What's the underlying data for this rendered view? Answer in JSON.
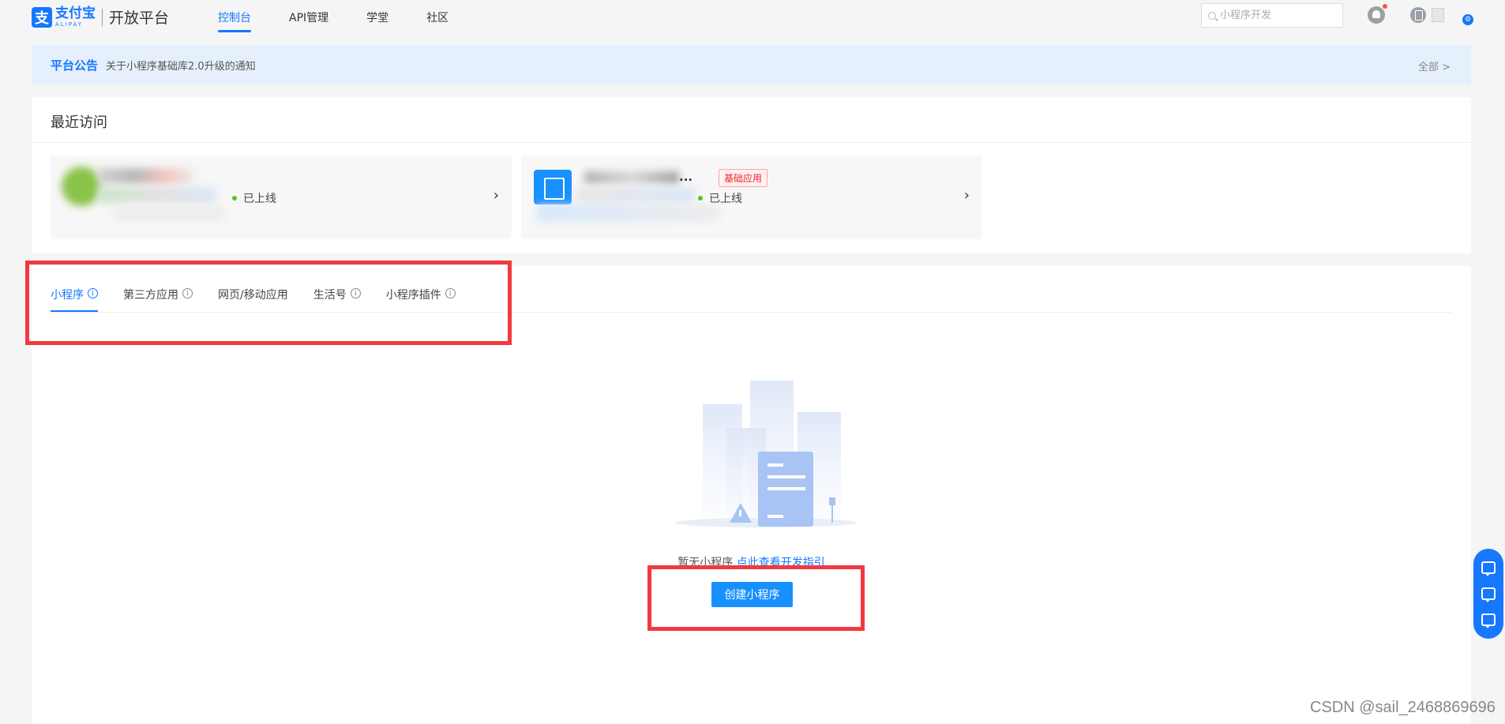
{
  "brand": {
    "name": "支付宝",
    "sub": "ALIPAY",
    "platform": "开放平台"
  },
  "nav": {
    "items": [
      {
        "label": "控制台",
        "active": true
      },
      {
        "label": "API管理"
      },
      {
        "label": "学堂"
      },
      {
        "label": "社区"
      }
    ]
  },
  "search": {
    "placeholder": "小程序开发"
  },
  "notice": {
    "label": "平台公告",
    "text": "关于小程序基础库2.0升级的通知",
    "all": "全部 >"
  },
  "recent": {
    "title": "最近访问",
    "cards": [
      {
        "status": "已上线"
      },
      {
        "name": "...",
        "badge": "基础应用",
        "status": "已上线"
      }
    ]
  },
  "tabs": [
    {
      "label": "小程序",
      "info": true,
      "active": true
    },
    {
      "label": "第三方应用",
      "info": true
    },
    {
      "label": "网页/移动应用",
      "info": false
    },
    {
      "label": "生活号",
      "info": true
    },
    {
      "label": "小程序插件",
      "info": true
    }
  ],
  "empty": {
    "text": "暂无小程序 ",
    "link": "点此查看开发指引",
    "button": "创建小程序"
  },
  "watermark": "CSDN @sail_2468869696",
  "colors": {
    "accent": "#1677ff",
    "annotation": "#f03a3f",
    "online": "#52c41a"
  }
}
